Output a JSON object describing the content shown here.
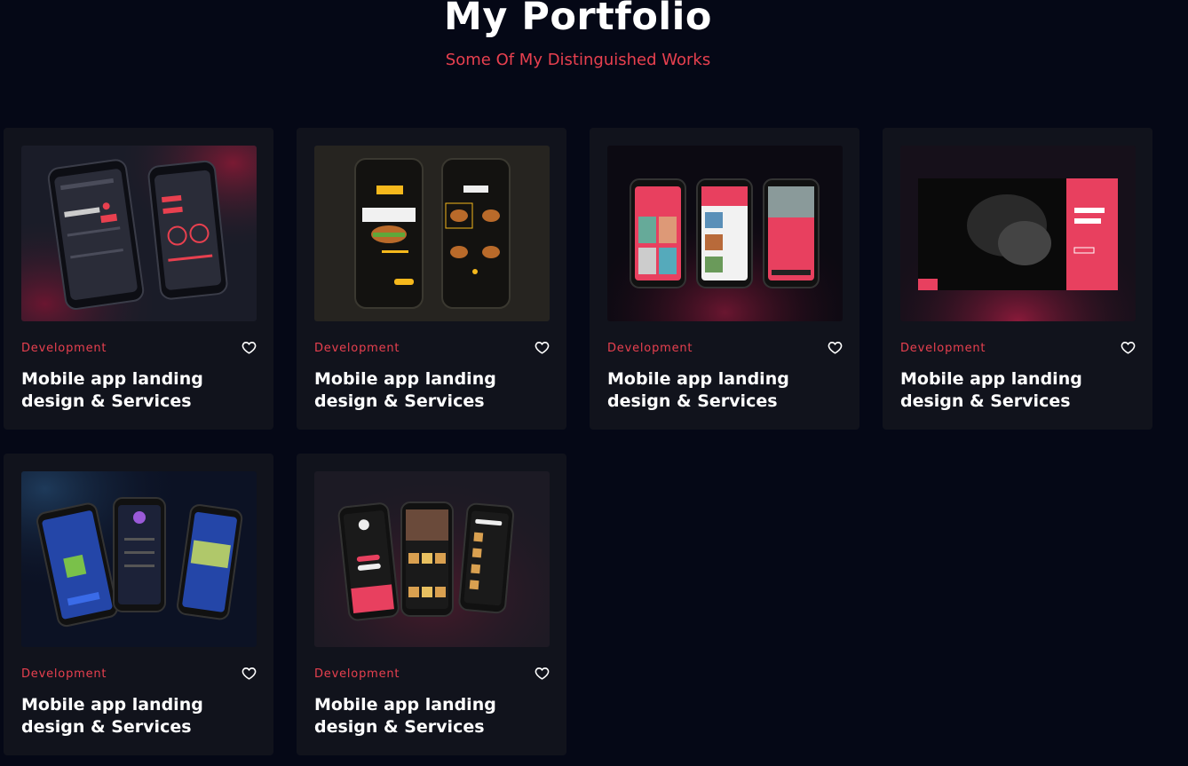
{
  "header": {
    "title": "My Portfolio",
    "subtitle": "Some Of My Distinguished Works"
  },
  "colors": {
    "background": "#050816",
    "card": "#11131c",
    "accent": "#e8404f",
    "text": "#ffffff"
  },
  "portfolio": {
    "items": [
      {
        "category": "Development",
        "title": "Mobile app landing design & Services",
        "image": "music-player-app-mockup",
        "favorite_icon": "heart-outline-icon"
      },
      {
        "category": "Development",
        "title": "Mobile app landing design & Services",
        "image": "burger-app-mockup",
        "favorite_icon": "heart-outline-icon"
      },
      {
        "category": "Development",
        "title": "Mobile app landing design & Services",
        "image": "travel-app-mockup",
        "favorite_icon": "heart-outline-icon"
      },
      {
        "category": "Development",
        "title": "Mobile app landing design & Services",
        "image": "workout-landing-mockup",
        "favorite_icon": "heart-outline-icon"
      },
      {
        "category": "Development",
        "title": "Mobile app landing design & Services",
        "image": "social-app-mockup",
        "favorite_icon": "heart-outline-icon"
      },
      {
        "category": "Development",
        "title": "Mobile app landing design & Services",
        "image": "food-bank-app-mockup",
        "favorite_icon": "heart-outline-icon"
      }
    ]
  }
}
